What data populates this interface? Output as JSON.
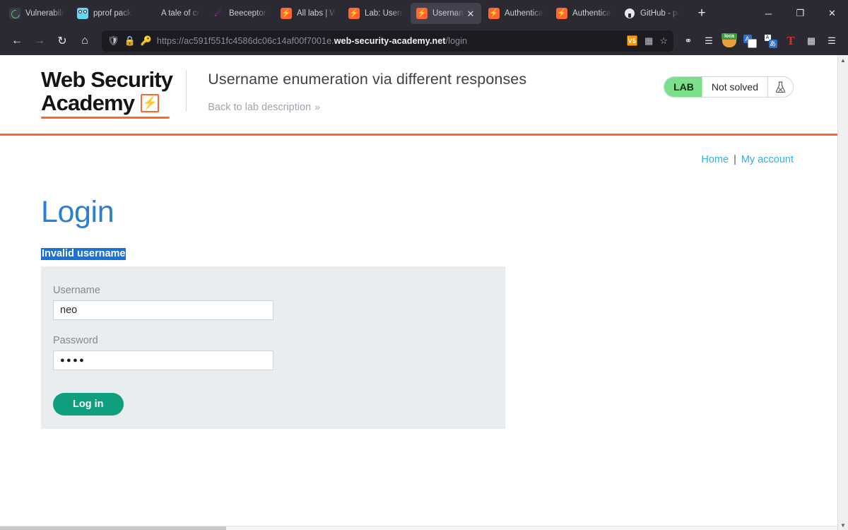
{
  "browser": {
    "tabs": [
      {
        "label": "Vulnerability",
        "favicon": "vulnerability-icon",
        "active": false
      },
      {
        "label": "pprof packa",
        "favicon": "gopher-icon",
        "active": false
      },
      {
        "label": "A tale of cri",
        "favicon": "none-icon",
        "active": false
      },
      {
        "label": "Beeceptor -",
        "favicon": "beeceptor-icon",
        "active": false
      },
      {
        "label": "All labs | We",
        "favicon": "portswigger-icon",
        "active": false
      },
      {
        "label": "Lab: Userna",
        "favicon": "portswigger-icon",
        "active": false
      },
      {
        "label": "Usernam",
        "favicon": "portswigger-icon",
        "active": true
      },
      {
        "label": "Authenticat",
        "favicon": "portswigger-icon",
        "active": false
      },
      {
        "label": "Authenticat",
        "favicon": "portswigger-icon",
        "active": false
      },
      {
        "label": "GitHub - pa",
        "favicon": "github-icon",
        "active": false
      }
    ],
    "new_tab_label": "+",
    "window_controls": {
      "minimize": "─",
      "maximize": "❐",
      "close": "✕"
    },
    "nav": {
      "back": "←",
      "forward": "→",
      "reload": "↻",
      "home": "⌂"
    },
    "url": {
      "prefix": "https://ac591f551fc4586dc06c14af00f7001e.",
      "domain": "web-security-academy.net",
      "path": "/login",
      "full": "https://ac591f551fc4586dc06c14af00f7001e.web-security-academy.net/login"
    },
    "url_icons": {
      "shield": "shield-icon",
      "lock": "padlock-icon",
      "key": "key-icon",
      "translate": "translate-page-icon",
      "reader": "extensions-in-address-icon",
      "bookmark": "bookmark-star-icon"
    },
    "toolbar_icons": [
      "pocket-icon",
      "library-icon",
      "localstack-extension-icon",
      "translate-extension-icon",
      "japanese-translate-extension-icon",
      "temper-extension-icon",
      "extensions-puzzle-icon",
      "app-menu-icon"
    ]
  },
  "page": {
    "logo": {
      "line1": "Web Security",
      "line2": "Academy",
      "bolt": "⚡"
    },
    "lab_title": "Username enumeration via different responses",
    "back_link": "Back to lab description",
    "back_chevron": "»",
    "lab_status": {
      "badge": "LAB",
      "state": "Not solved",
      "flask": "flask-icon"
    },
    "topnav": {
      "home": "Home",
      "separator": "|",
      "account": "My account"
    },
    "heading": "Login",
    "error_message": "Invalid username",
    "form": {
      "username_label": "Username",
      "username_value": "neo",
      "username_placeholder": "",
      "password_label": "Password",
      "password_value": "●●●●",
      "password_placeholder": "",
      "submit_label": "Log in"
    }
  },
  "colors": {
    "accent_orange": "#ff6633",
    "link_blue": "#31b0e8",
    "heading_blue": "#2c7fd1",
    "button_teal": "#0f9e7e",
    "lab_green": "#7ce08a",
    "selection_blue": "#1a73d4",
    "form_bg": "#e9edf0"
  }
}
